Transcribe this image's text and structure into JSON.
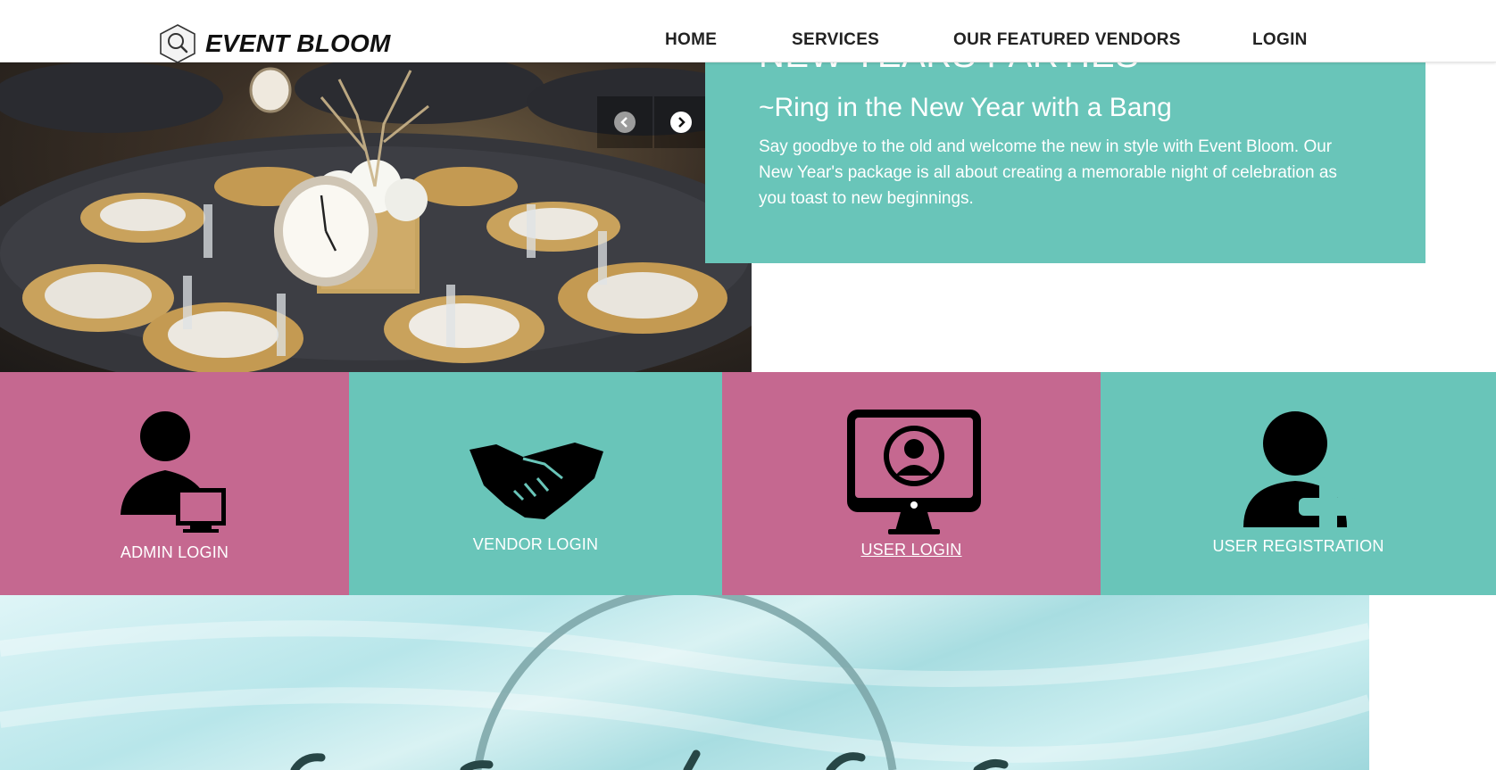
{
  "brand": {
    "name": "EVENT BLOOM"
  },
  "nav": {
    "home": "HOME",
    "services": "SERVICES",
    "vendors": "OUR FEATURED VENDORS",
    "login": "LOGIN"
  },
  "hero": {
    "title": "NEW YEARS PARTIES",
    "subtitle": "~Ring in the New Year with a Bang",
    "body": "Say goodbye to the old and welcome the new in style with Event Bloom. Our New Year's package is all about creating a memorable night of celebration as you toast to new beginnings."
  },
  "tiles": [
    {
      "label": "ADMIN LOGIN",
      "icon": "admin-computer-icon",
      "color": "#c56890"
    },
    {
      "label": "VENDOR LOGIN",
      "icon": "handshake-icon",
      "color": "#69c5b9"
    },
    {
      "label": "USER LOGIN",
      "icon": "user-monitor-icon",
      "color": "#c56890"
    },
    {
      "label": "USER REGISTRATION",
      "icon": "user-add-icon",
      "color": "#69c5b9"
    }
  ],
  "colors": {
    "teal": "#69c5b9",
    "pink": "#c56890"
  }
}
